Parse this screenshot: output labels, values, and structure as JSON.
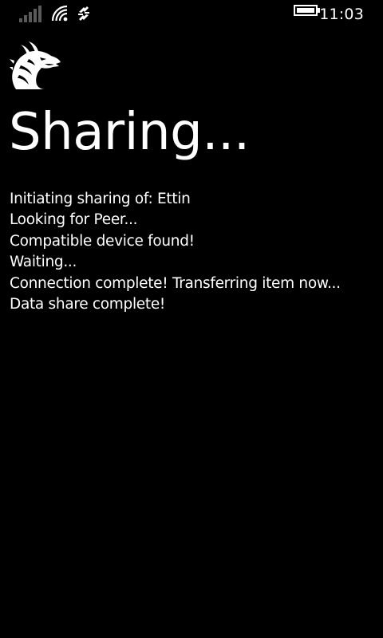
{
  "status_bar": {
    "time": "11:03",
    "icons": [
      "signal-strength-icon",
      "wifi-icon",
      "data-sync-icon",
      "battery-icon"
    ]
  },
  "app": {
    "logo_icon": "dragon-head-icon"
  },
  "page": {
    "title": "Sharing..."
  },
  "log": {
    "lines": [
      "Initiating sharing of: Ettin",
      "Looking for Peer...",
      "Compatible device found!",
      "Waiting...",
      "Connection complete!  Transferring item now...",
      "Data share complete!"
    ]
  },
  "colors": {
    "background": "#000000",
    "foreground": "#ffffff",
    "dim_signal": "#5a5a5a"
  }
}
